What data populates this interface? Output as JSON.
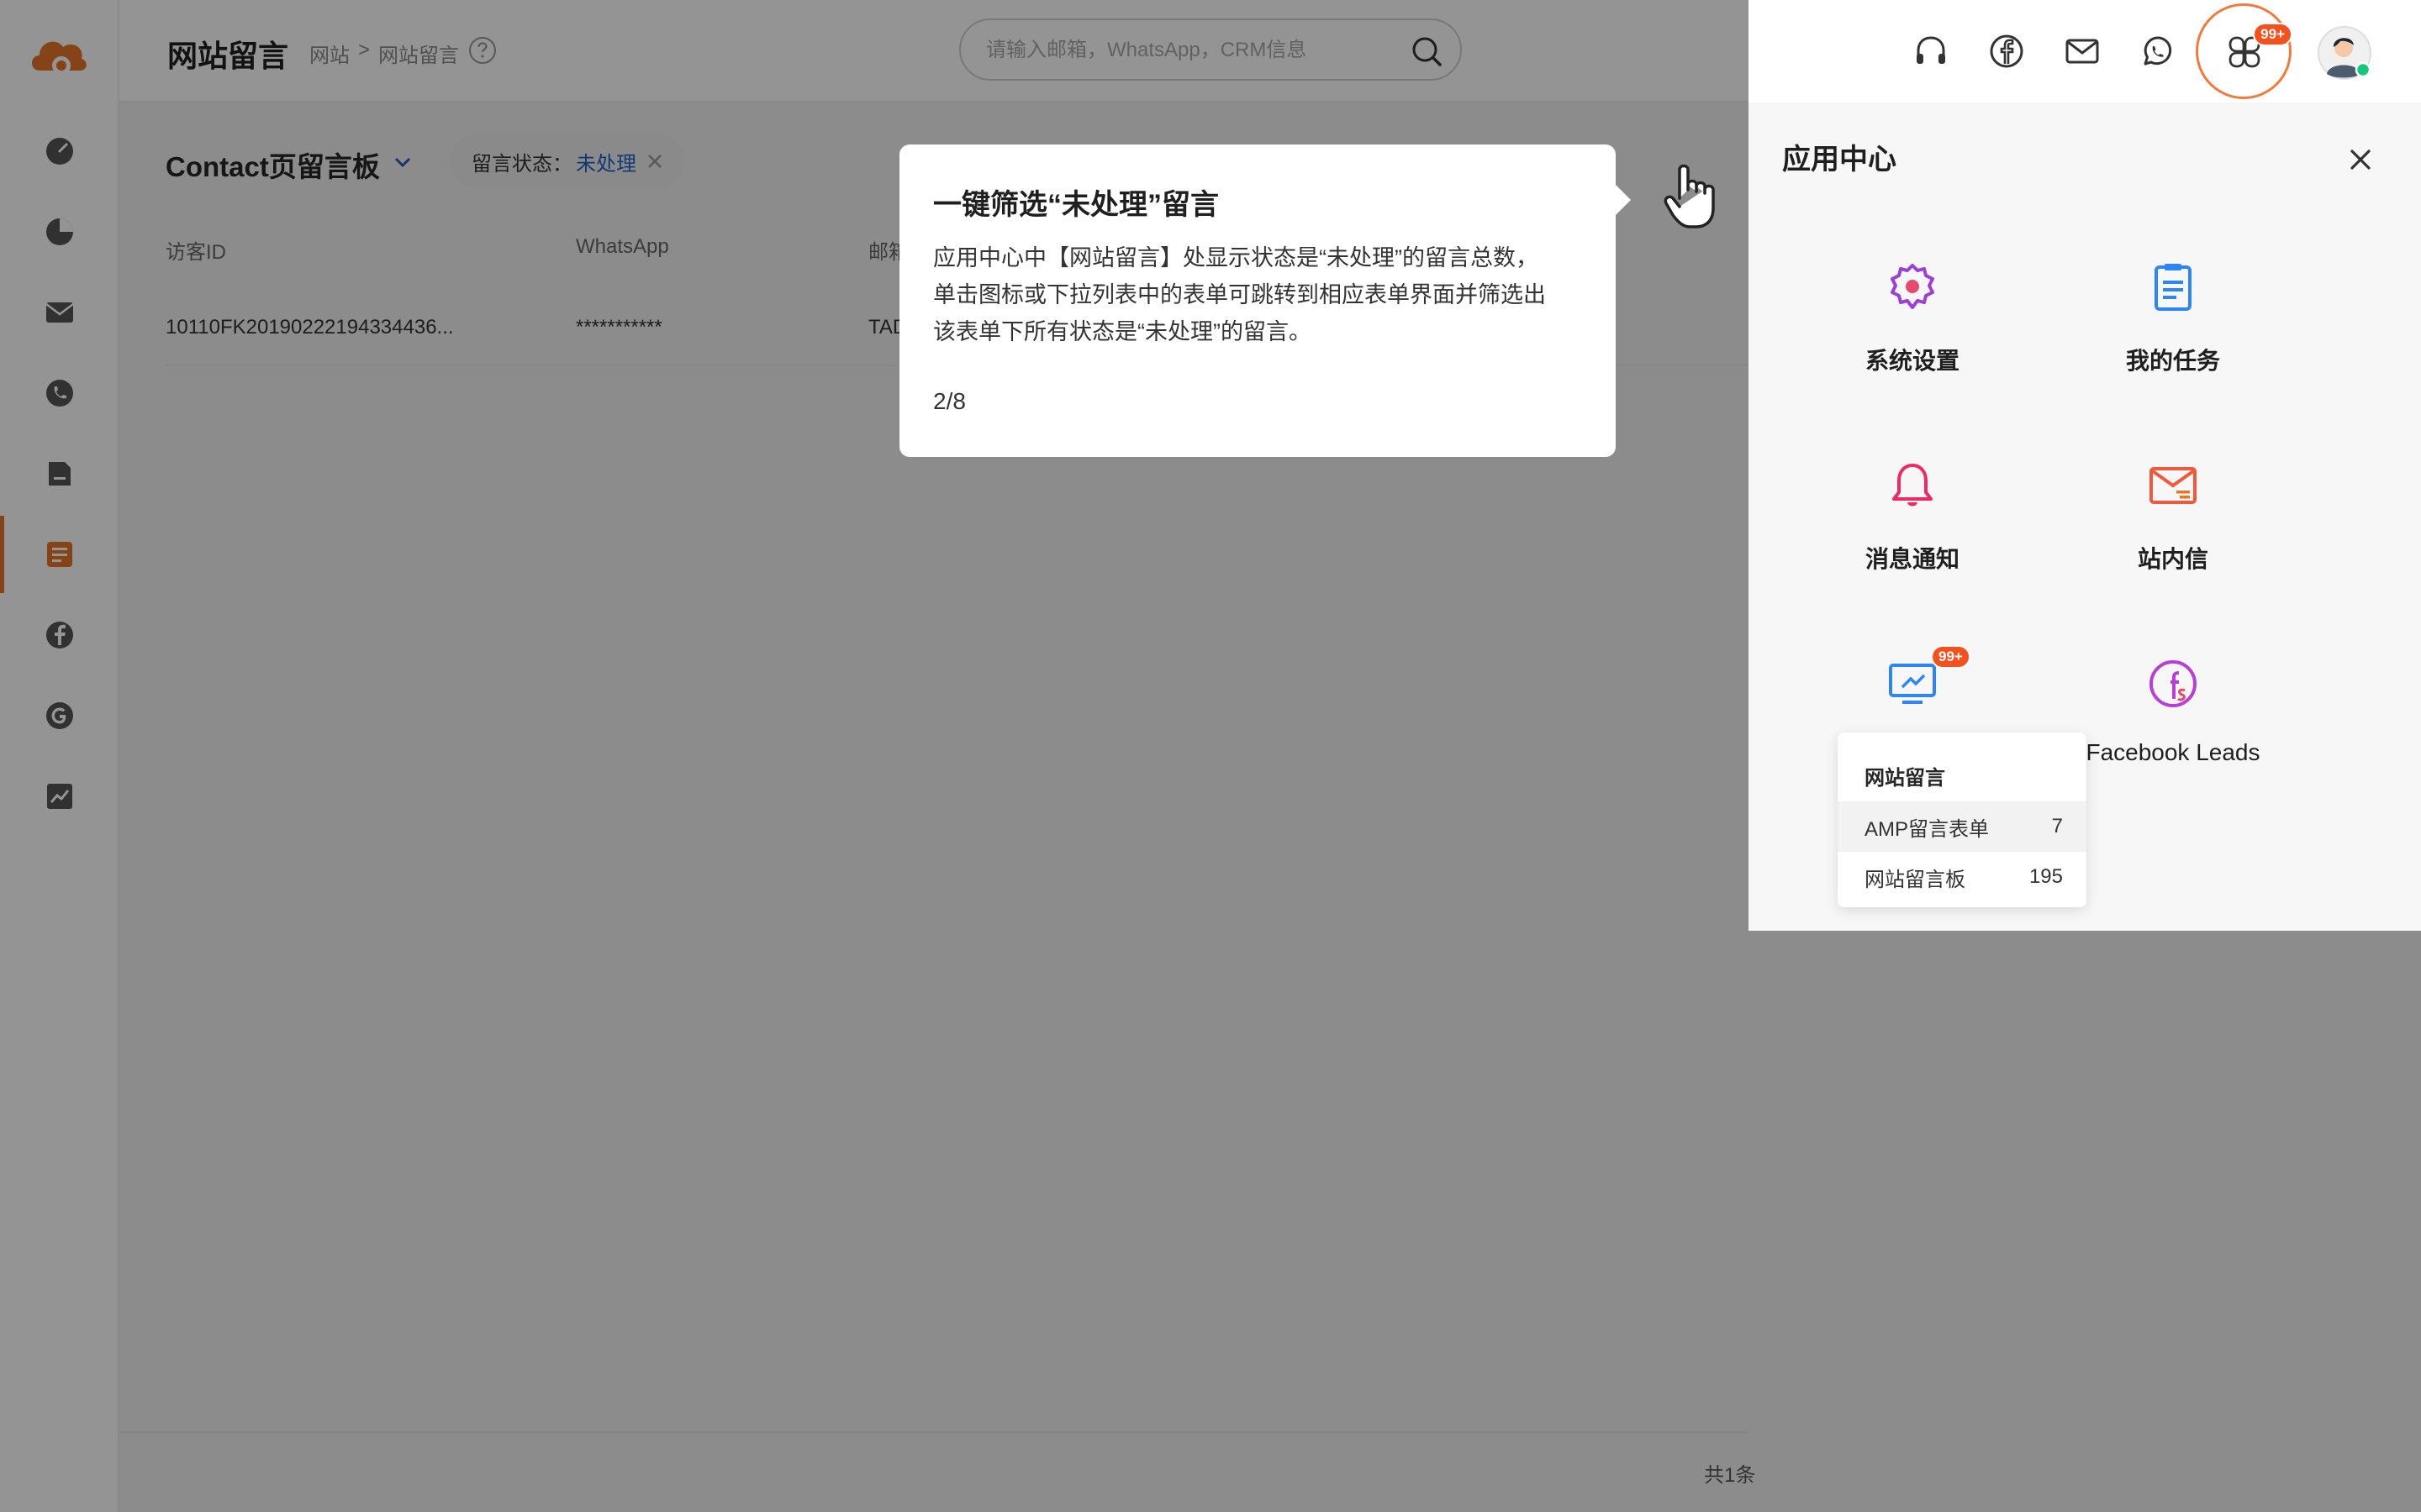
{
  "header": {
    "title": "网站留言",
    "breadcrumb": [
      "网站",
      ">",
      "网站留言"
    ],
    "search_placeholder": "请输入邮箱，WhatsApp，CRM信息"
  },
  "board": {
    "title": "Contact页留言板",
    "filter_label": "留言状态：",
    "filter_value": "未处理"
  },
  "table": {
    "columns": [
      "访客ID",
      "WhatsApp",
      "邮箱"
    ],
    "rows": [
      [
        "10110FK20190222194334436...",
        "***********",
        "TAD"
      ]
    ],
    "total": "共1条"
  },
  "tooltip": {
    "title": "一键筛选“未处理”留言",
    "body_lines": [
      "应用中心中【网站留言】处显示状态是“未处理”的留言总数，",
      "单击图标或下拉列表中的表单可跳转到相应表单界面并筛选出",
      "该表单下所有状态是“未处理”的留言。"
    ],
    "step": "2/8"
  },
  "topbar": {
    "apps_badge": "99+",
    "icons": [
      "headset-icon",
      "facebook-icon",
      "mail-icon",
      "whatsapp-icon",
      "apps-grid-icon",
      "avatar"
    ]
  },
  "app_center": {
    "title": "应用中心",
    "apps": [
      {
        "label": "系统设置",
        "icon": "gear-icon",
        "color": "#9b3fd6"
      },
      {
        "label": "我的任务",
        "icon": "clipboard-icon",
        "color": "#2f86f2"
      },
      {
        "label": "消息通知",
        "icon": "bell-icon",
        "color": "#ee2a63"
      },
      {
        "label": "站内信",
        "icon": "envelope-icon",
        "color": "#f05a3c"
      },
      {
        "label": "",
        "icon": "monitor-icon",
        "color": "#2f86f2",
        "badge": "99+"
      },
      {
        "label": "Facebook Leads",
        "icon": "facebook-leads-icon",
        "color": "#b83fd6"
      }
    ],
    "dropdown": {
      "header": "网站留言",
      "items": [
        {
          "label": "AMP留言表单",
          "count": "7"
        },
        {
          "label": "网站留言板",
          "count": "195"
        }
      ]
    }
  },
  "colors": {
    "accent": "#e8742a",
    "link": "#1f63c6",
    "badge": "#f4511e"
  }
}
